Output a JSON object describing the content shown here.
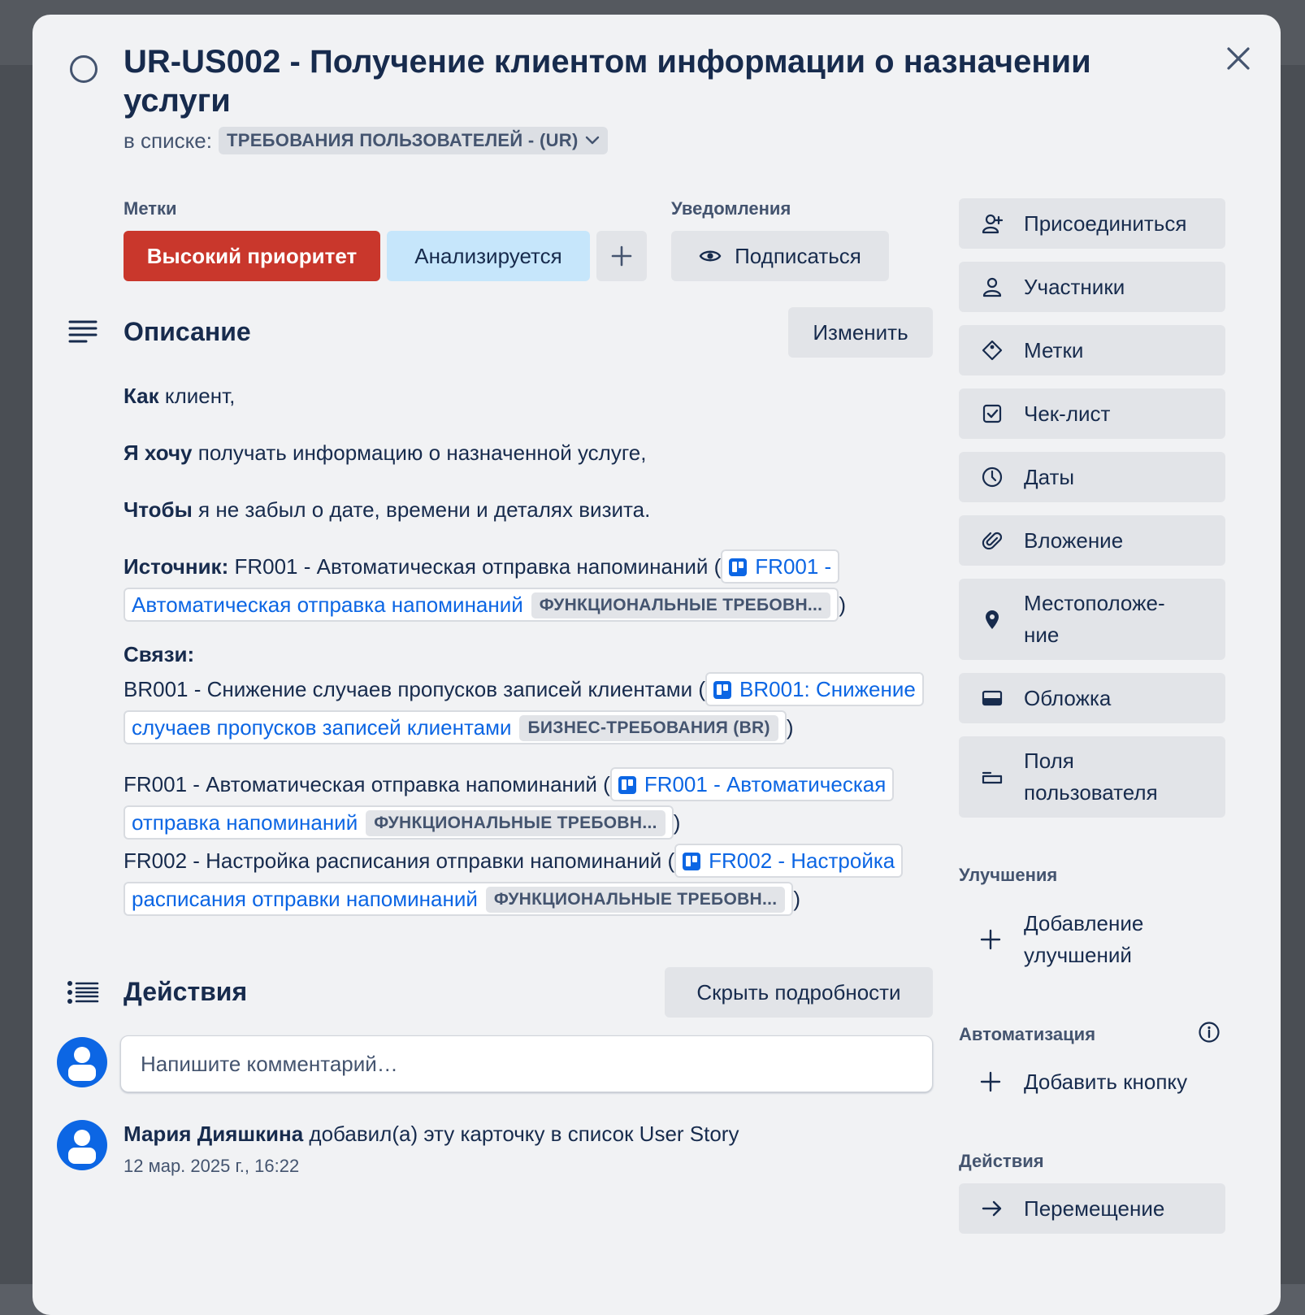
{
  "card": {
    "title": "UR-US002 - Получение клиентом информации о назначении услуги",
    "in_list_label": "в списке:",
    "list_name": "ТРЕБОВАНИЯ ПОЛЬЗОВАТЕЛЕЙ - (UR)"
  },
  "labels": {
    "heading": "Метки",
    "items": [
      {
        "text": "Высокий приоритет",
        "color": "#c9372c"
      },
      {
        "text": "Анализируется",
        "color": "#c6e6fb"
      }
    ]
  },
  "notifications": {
    "heading": "Уведомления",
    "button": "Подписаться"
  },
  "description": {
    "heading": "Описание",
    "edit_button": "Изменить",
    "line1_bold": "Как",
    "line1_rest": " клиент,",
    "line2_bold": "Я хочу",
    "line2_rest": " получать информацию о назначенной услуге,",
    "line3_bold": "Чтобы",
    "line3_rest": " я не забыл о дате, времени и деталях визита.",
    "source_label": "Источник:",
    "source_text": " FR001 - Автоматическая отправка напоминаний (",
    "source_link": "FR001 - Автоматическая отправка напоминаний",
    "source_tag": "ФУНКЦИОНАЛЬНЫЕ ТРЕБОВН...",
    "links_label": "Связи:",
    "links": [
      {
        "text": "BR001 - Снижение случаев пропусков записей клиентами (",
        "link": "BR001: Снижение случаев пропусков записей клиентами",
        "tag": "БИЗНЕС-ТРЕБОВАНИЯ (BR)"
      },
      {
        "text": "FR001 - Автоматическая отправка напоминаний (",
        "link": "FR001 - Автоматическая отправка напоминаний",
        "tag": "ФУНКЦИОНАЛЬНЫЕ ТРЕБОВН..."
      },
      {
        "text": "FR002 - Настройка расписания отправки напоминаний (",
        "link": "FR002 - Настройка расписания отправки напоминаний",
        "tag": "ФУНКЦИОНАЛЬНЫЕ ТРЕБОВН..."
      }
    ],
    "close_paren": ")"
  },
  "activity": {
    "heading": "Действия",
    "hide_button": "Скрыть подробности",
    "comment_placeholder": "Напишите комментарий…",
    "entry_author": "Мария Дияшкина",
    "entry_text": " добавил(а) эту карточку в список User Story",
    "entry_time": "12 мар. 2025 г., 16:22"
  },
  "sidebar": {
    "buttons": [
      {
        "label": "Присоединиться",
        "icon": "add-person-icon"
      },
      {
        "label": "Участники",
        "icon": "person-icon"
      },
      {
        "label": "Метки",
        "icon": "label-icon"
      },
      {
        "label": "Чек-лист",
        "icon": "checklist-icon"
      },
      {
        "label": "Даты",
        "icon": "clock-icon"
      },
      {
        "label": "Вложение",
        "icon": "paperclip-icon"
      },
      {
        "label": "Местоположе-\nние",
        "icon": "location-pin-icon"
      },
      {
        "label": "Обложка",
        "icon": "cover-icon"
      },
      {
        "label": "Поля пользователя",
        "icon": "custom-fields-icon"
      }
    ],
    "powerups_heading": "Улучшения",
    "powerups_add": "Добавление улучшений",
    "automation_heading": "Автоматизация",
    "automation_add": "Добавить кнопку",
    "actions_heading": "Действия",
    "move_button": "Перемещение"
  },
  "colors": {
    "accent_blue": "#0c66e4",
    "label_red": "#c9372c",
    "label_blue": "#c6e6fb",
    "modal_bg": "#f1f2f4"
  }
}
